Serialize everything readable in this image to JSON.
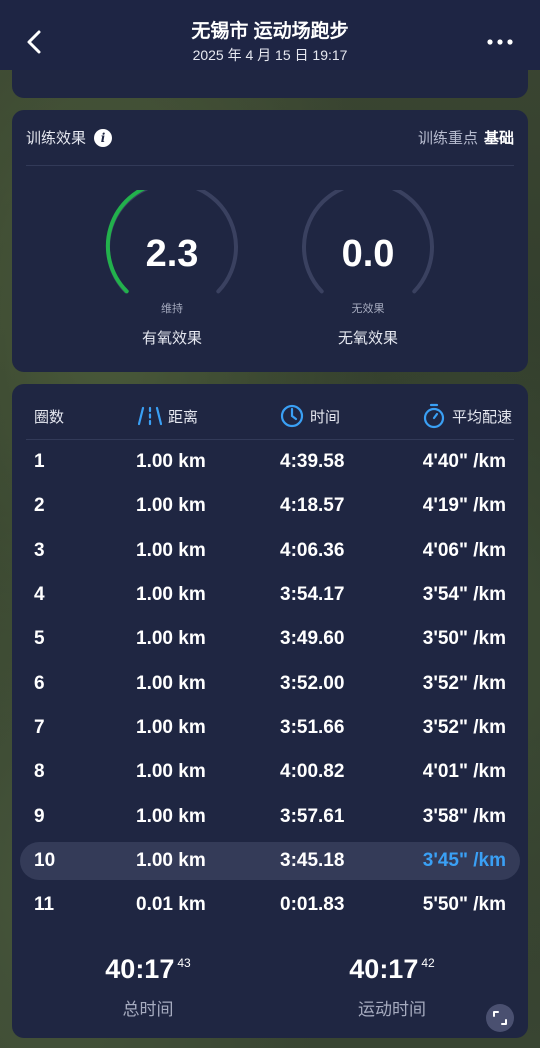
{
  "header": {
    "title": "无锡市 运动场跑步",
    "subtitle": "2025 年 4 月 15 日 19:17",
    "back_icon": "chevron-left-icon",
    "more_icon": "more-horizontal-icon"
  },
  "training": {
    "title": "训练效果",
    "focus_label": "训练重点",
    "focus_value": "基础",
    "aerobic": {
      "value": "2.3",
      "level": "维持",
      "label": "有氧效果",
      "fraction": 0.46
    },
    "anaerobic": {
      "value": "0.0",
      "level": "无效果",
      "label": "无氧效果",
      "fraction": 0.0
    },
    "colors": {
      "aerobic": "#22b14c",
      "track": "#3a4160"
    }
  },
  "laps": {
    "headers": {
      "lap": "圈数",
      "distance": "距离",
      "time": "时间",
      "pace": "平均配速"
    },
    "rows": [
      {
        "lap": "1",
        "distance": "1.00 km",
        "time": "4:39.58",
        "pace": "4'40\" /km"
      },
      {
        "lap": "2",
        "distance": "1.00 km",
        "time": "4:18.57",
        "pace": "4'19\" /km"
      },
      {
        "lap": "3",
        "distance": "1.00 km",
        "time": "4:06.36",
        "pace": "4'06\" /km"
      },
      {
        "lap": "4",
        "distance": "1.00 km",
        "time": "3:54.17",
        "pace": "3'54\" /km"
      },
      {
        "lap": "5",
        "distance": "1.00 km",
        "time": "3:49.60",
        "pace": "3'50\" /km"
      },
      {
        "lap": "6",
        "distance": "1.00 km",
        "time": "3:52.00",
        "pace": "3'52\" /km"
      },
      {
        "lap": "7",
        "distance": "1.00 km",
        "time": "3:51.66",
        "pace": "3'52\" /km"
      },
      {
        "lap": "8",
        "distance": "1.00 km",
        "time": "4:00.82",
        "pace": "4'01\" /km"
      },
      {
        "lap": "9",
        "distance": "1.00 km",
        "time": "3:57.61",
        "pace": "3'58\" /km"
      },
      {
        "lap": "10",
        "distance": "1.00 km",
        "time": "3:45.18",
        "pace": "3'45\" /km"
      },
      {
        "lap": "11",
        "distance": "0.01 km",
        "time": "0:01.83",
        "pace": "5'50\" /km"
      }
    ],
    "highlight_lap": "10",
    "accent": "#3aa0f5"
  },
  "totals": {
    "total_time_main": "40:17",
    "total_time_sub": "43",
    "total_time_label": "总时间",
    "moving_time_main": "40:17",
    "moving_time_sub": "42",
    "moving_time_label": "运动时间"
  }
}
